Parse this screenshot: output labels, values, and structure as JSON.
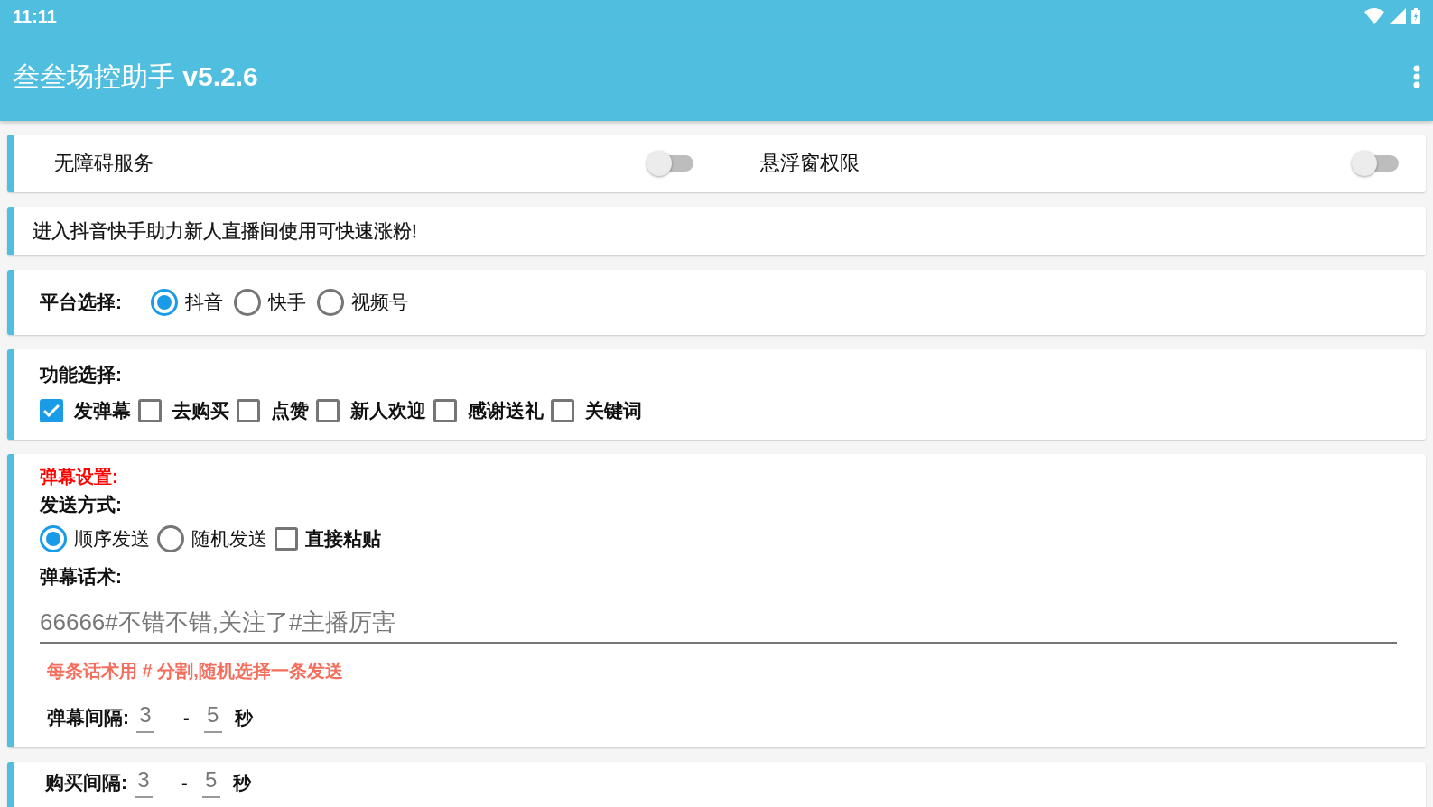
{
  "status_bar": {
    "time": "11:11"
  },
  "app_bar": {
    "title": "叁叁场控助手 **v5.2.6**"
  },
  "permissions": [
    {
      "label": "无障碍服务",
      "on": false
    },
    {
      "label": "悬浮窗权限",
      "on": false
    }
  ],
  "notice": "进入抖音快手助力新人直播间使用可快速涨粉!",
  "platform": {
    "label": "平台选择:",
    "options": [
      {
        "label": "抖音",
        "selected": true
      },
      {
        "label": "快手",
        "selected": false
      },
      {
        "label": "视频号",
        "selected": false
      }
    ]
  },
  "functions": {
    "label": "功能选择:",
    "options": [
      {
        "label": "发弹幕",
        "checked": true
      },
      {
        "label": "去购买",
        "checked": false
      },
      {
        "label": "点赞",
        "checked": false
      },
      {
        "label": "新人欢迎",
        "checked": false
      },
      {
        "label": "感谢送礼",
        "checked": false
      },
      {
        "label": "关键词",
        "checked": false
      }
    ]
  },
  "danmu_settings": {
    "heading": "弹幕设置:",
    "send_mode_label": "发送方式:",
    "send_modes": [
      {
        "kind": "radio",
        "label": "顺序发送",
        "selected": true
      },
      {
        "kind": "radio",
        "label": "随机发送",
        "selected": false
      },
      {
        "kind": "checkbox",
        "label": "直接粘贴",
        "checked": false
      }
    ],
    "script_label": "弹幕话术:",
    "script_value": "66666#不错不错,关注了#主播厉害",
    "hint": "每条话术用 # 分割,随机选择一条发送",
    "interval": {
      "label": "弹幕间隔:",
      "from": "3",
      "separator": "-",
      "to": "5",
      "unit": "秒"
    }
  },
  "purchase": {
    "interval": {
      "label": "购买间隔:",
      "from": "3",
      "separator": "-",
      "to": "5",
      "unit": "秒"
    }
  }
}
